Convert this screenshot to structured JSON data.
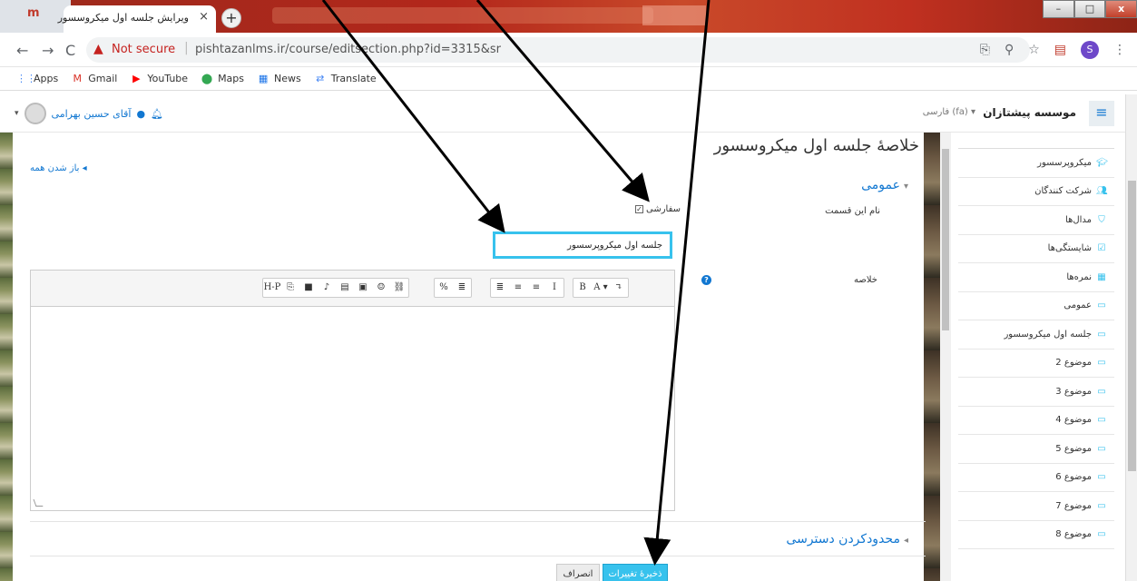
{
  "browser": {
    "tab_title": "ویرایش جلسه اول میکروسسور",
    "tab_close": "×",
    "new_tab": "+",
    "not_secure": "Not secure",
    "url": "pishtazanlms.ir/course/editsection.php?id=3315&sr",
    "profile_initial": "S",
    "bookmarks": [
      {
        "label": "Apps",
        "icon": "apps-grid-icon",
        "color": "#4285f4"
      },
      {
        "label": "Gmail",
        "icon": "gmail-icon",
        "color": "#d93025"
      },
      {
        "label": "YouTube",
        "icon": "youtube-icon",
        "color": "#ff0000"
      },
      {
        "label": "Maps",
        "icon": "maps-pin-icon",
        "color": "#34a853"
      },
      {
        "label": "News",
        "icon": "news-icon",
        "color": "#1a73e8"
      },
      {
        "label": "Translate",
        "icon": "translate-icon",
        "color": "#4285f4"
      }
    ]
  },
  "header": {
    "site_name": "موسسه پیشتازان",
    "language": "فارسی (fa) ▾",
    "user_name": "آقای حسین بهرامی"
  },
  "main": {
    "page_title": "خلاصهٔ جلسه اول میکروسسور",
    "expand_all": "باز شدن همه",
    "section_general": "عمومی",
    "section_name_label": "نام این قسمت",
    "custom_label": "سفارشی",
    "section_name_value": "جلسه اول میکروپرسسور",
    "summary_label": "خلاصه",
    "restrict_access": "محدودکردن دسترسی",
    "save_button": "ذخیرهٔ تغییرات",
    "cancel_button": "انصراف"
  },
  "editor_toolbar": [
    "↴",
    "A ▾",
    "B",
    "I",
    "≡",
    "≡",
    "≣",
    "≣",
    "%",
    "⛓",
    "☺",
    "▣",
    "▤",
    "♪",
    "■",
    "⎘",
    "H-P"
  ],
  "sidebar": {
    "items": [
      {
        "label": "میکروپرسسور",
        "icon": "graduation-cap-icon"
      },
      {
        "label": "شرکت کنندگان",
        "icon": "users-icon"
      },
      {
        "label": "مدال‌ها",
        "icon": "shield-badge-icon"
      },
      {
        "label": "شایستگی‌ها",
        "icon": "checkbox-icon"
      },
      {
        "label": "نمره‌ها",
        "icon": "table-grid-icon"
      },
      {
        "label": "عمومی",
        "icon": "folder-icon"
      },
      {
        "label": "جلسه اول میکروسسور",
        "icon": "folder-icon"
      },
      {
        "label": "موضوع 2",
        "icon": "folder-icon"
      },
      {
        "label": "موضوع 3",
        "icon": "folder-icon"
      },
      {
        "label": "موضوع 4",
        "icon": "folder-icon"
      },
      {
        "label": "موضوع 5",
        "icon": "folder-icon"
      },
      {
        "label": "موضوع 6",
        "icon": "folder-icon"
      },
      {
        "label": "موضوع 7",
        "icon": "folder-icon"
      },
      {
        "label": "موضوع 8",
        "icon": "folder-icon"
      }
    ]
  },
  "colors": {
    "accent": "#1177d1",
    "highlight": "#37c2ed"
  }
}
